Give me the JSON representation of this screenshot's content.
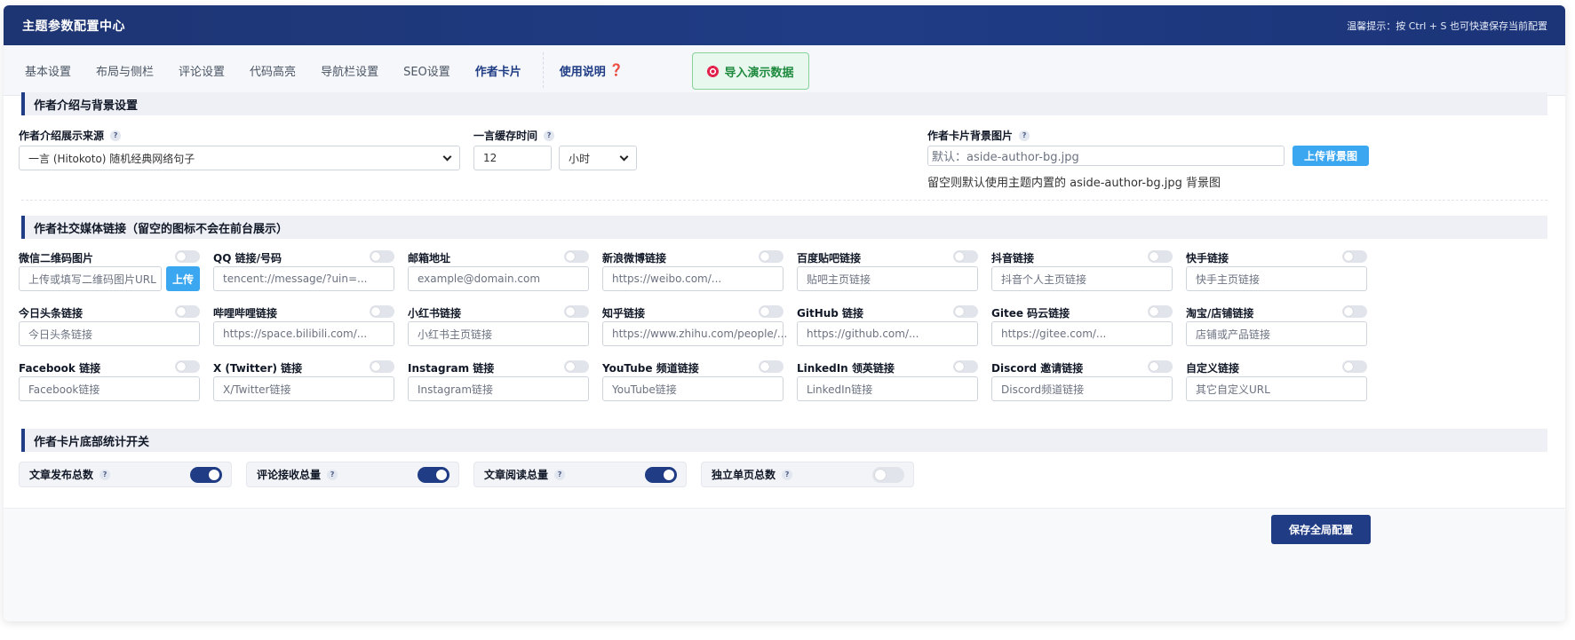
{
  "header": {
    "title": "主题参数配置中心",
    "tip": "温馨提示：按 Ctrl + S 也可快速保存当前配置"
  },
  "tabs": [
    {
      "label": "基本设置"
    },
    {
      "label": "布局与侧栏"
    },
    {
      "label": "评论设置"
    },
    {
      "label": "代码高亮"
    },
    {
      "label": "导航栏设置"
    },
    {
      "label": "SEO设置"
    },
    {
      "label": "作者卡片",
      "active": true
    }
  ],
  "help_tab": {
    "label": "使用说明",
    "icon": "question-mark-icon",
    "mark": "❓"
  },
  "import_button": {
    "label": "导入演示数据",
    "icon": "dart-target-icon"
  },
  "section1": {
    "title": "作者介绍与背景设置",
    "source": {
      "label": "作者介绍展示来源",
      "value": "一言 (Hitokoto) 随机经典网络句子"
    },
    "cache": {
      "label": "一言缓存时间",
      "value": "12",
      "unit": "小时"
    },
    "bg": {
      "label": "作者卡片背景图片",
      "placeholder": "默认：aside-author-bg.jpg",
      "upload": "上传背景图",
      "hint": "留空则默认使用主题内置的 aside-author-bg.jpg 背景图"
    }
  },
  "section2": {
    "title": "作者社交媒体链接（留空的图标不会在前台展示）",
    "upload_label": "上传",
    "links": [
      {
        "label": "微信二维码图片",
        "placeholder": "上传或填写二维码图片URL"
      },
      {
        "label": "QQ 链接/号码",
        "placeholder": "tencent://message/?uin=..."
      },
      {
        "label": "邮箱地址",
        "placeholder": "example@domain.com"
      },
      {
        "label": "新浪微博链接",
        "placeholder": "https://weibo.com/..."
      },
      {
        "label": "百度贴吧链接",
        "placeholder": "贴吧主页链接"
      },
      {
        "label": "抖音链接",
        "placeholder": "抖音个人主页链接"
      },
      {
        "label": "快手链接",
        "placeholder": "快手主页链接"
      },
      {
        "label": "今日头条链接",
        "placeholder": "今日头条链接"
      },
      {
        "label": "哔哩哔哩链接",
        "placeholder": "https://space.bilibili.com/..."
      },
      {
        "label": "小红书链接",
        "placeholder": "小红书主页链接"
      },
      {
        "label": "知乎链接",
        "placeholder": "https://www.zhihu.com/people/..."
      },
      {
        "label": "GitHub 链接",
        "placeholder": "https://github.com/..."
      },
      {
        "label": "Gitee 码云链接",
        "placeholder": "https://gitee.com/..."
      },
      {
        "label": "淘宝/店铺链接",
        "placeholder": "店铺或产品链接"
      },
      {
        "label": "Facebook 链接",
        "placeholder": "Facebook链接"
      },
      {
        "label": "X (Twitter) 链接",
        "placeholder": "X/Twitter链接"
      },
      {
        "label": "Instagram 链接",
        "placeholder": "Instagram链接"
      },
      {
        "label": "YouTube 频道链接",
        "placeholder": "YouTube链接"
      },
      {
        "label": "LinkedIn 领英链接",
        "placeholder": "LinkedIn链接"
      },
      {
        "label": "Discord 邀请链接",
        "placeholder": "Discord频道链接"
      },
      {
        "label": "自定义链接",
        "placeholder": "其它自定义URL"
      }
    ]
  },
  "section3": {
    "title": "作者卡片底部统计开关",
    "stats": [
      {
        "label": "文章发布总数",
        "on": true
      },
      {
        "label": "评论接收总量",
        "on": true
      },
      {
        "label": "文章阅读总量",
        "on": true
      },
      {
        "label": "独立单页总数",
        "on": false
      }
    ]
  },
  "help_mark": "?",
  "save_button": "保存全局配置"
}
